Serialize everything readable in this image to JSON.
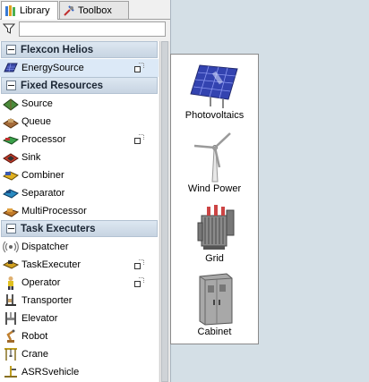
{
  "tabs": [
    {
      "label": "Library",
      "icon": "library-icon",
      "active": true
    },
    {
      "label": "Toolbox",
      "icon": "toolbox-icon",
      "active": false
    }
  ],
  "filter": {
    "icon": "filter-icon",
    "value": ""
  },
  "categories": [
    {
      "label": "Flexcon Helios",
      "items": [
        {
          "label": "EnergySource",
          "icon": "energy-source-icon",
          "selected": true,
          "has_popout": true
        }
      ]
    },
    {
      "label": "Fixed Resources",
      "items": [
        {
          "label": "Source",
          "icon": "source-icon"
        },
        {
          "label": "Queue",
          "icon": "queue-icon"
        },
        {
          "label": "Processor",
          "icon": "processor-icon",
          "has_popout": true
        },
        {
          "label": "Sink",
          "icon": "sink-icon"
        },
        {
          "label": "Combiner",
          "icon": "combiner-icon"
        },
        {
          "label": "Separator",
          "icon": "separator-icon"
        },
        {
          "label": "MultiProcessor",
          "icon": "multiprocessor-icon"
        }
      ]
    },
    {
      "label": "Task Executers",
      "items": [
        {
          "label": "Dispatcher",
          "icon": "dispatcher-icon"
        },
        {
          "label": "TaskExecuter",
          "icon": "taskexecuter-icon",
          "has_popout": true
        },
        {
          "label": "Operator",
          "icon": "operator-icon",
          "has_popout": true
        },
        {
          "label": "Transporter",
          "icon": "transporter-icon"
        },
        {
          "label": "Elevator",
          "icon": "elevator-icon"
        },
        {
          "label": "Robot",
          "icon": "robot-icon"
        },
        {
          "label": "Crane",
          "icon": "crane-icon"
        },
        {
          "label": "ASRSvehicle",
          "icon": "asrs-vehicle-icon"
        }
      ]
    }
  ],
  "preview": {
    "items": [
      {
        "label": "Photovoltaics",
        "icon": "solar-panel-icon"
      },
      {
        "label": "Wind Power",
        "icon": "wind-turbine-icon"
      },
      {
        "label": "Grid",
        "icon": "transformer-icon"
      },
      {
        "label": "Cabinet",
        "icon": "cabinet-icon"
      }
    ]
  }
}
